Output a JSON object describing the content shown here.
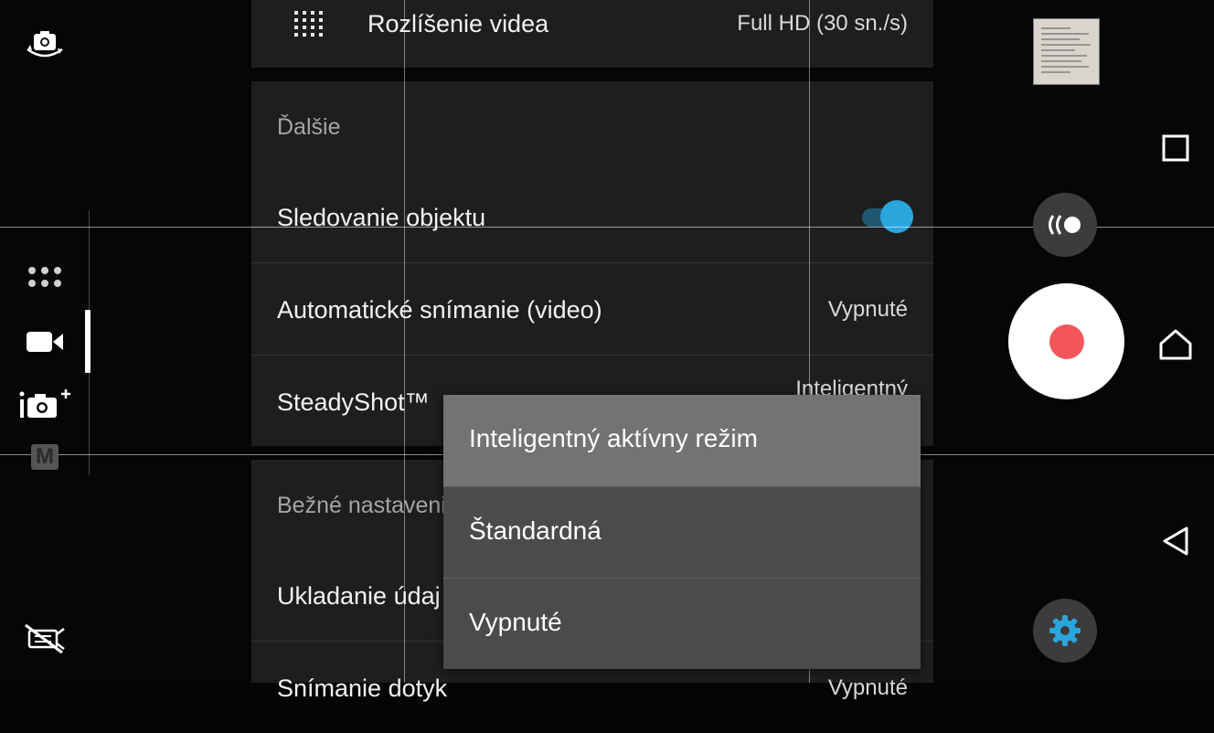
{
  "settings": {
    "top_row": {
      "label": "Rozlíšenie videa",
      "value": "Full HD (30 sn./s)",
      "icon": "grid-icon"
    },
    "section_more": {
      "title": "Ďalšie",
      "rows": [
        {
          "label": "Sledovanie objektu",
          "type": "toggle",
          "state": "on"
        },
        {
          "label": "Automatické snímanie (video)",
          "value": "Vypnuté"
        },
        {
          "label": "SteadyShot™",
          "value": "Inteligentný"
        }
      ]
    },
    "section_common": {
      "title": "Bežné nastavenie",
      "rows": [
        {
          "label": "Ukladanie údaj"
        },
        {
          "label": "Snímanie dotyk",
          "value": "Vypnuté"
        }
      ]
    }
  },
  "popup": {
    "options": [
      "Inteligentný aktívny režim",
      "Štandardná",
      "Vypnuté"
    ],
    "selected_index": 0
  },
  "left_rail": {
    "icons": [
      "switch-camera-icon",
      "more-modes-icon",
      "video-mode-icon",
      "superior-auto-icon",
      "manual-mode-icon",
      "flash-off-icon"
    ],
    "manual_label": "M"
  },
  "right_controls": {
    "icons": [
      "gallery-thumbnail",
      "burst-mode-icon",
      "record-button",
      "settings-gear-icon"
    ]
  },
  "nav": {
    "icons": [
      "recent-apps-icon",
      "home-icon",
      "back-icon"
    ]
  },
  "colors": {
    "accent": "#2ba6dd",
    "record": "#f2565a",
    "toggle_track": "#1f5670",
    "popup_bg": "#4b4b4b",
    "popup_selected": "#737373"
  }
}
